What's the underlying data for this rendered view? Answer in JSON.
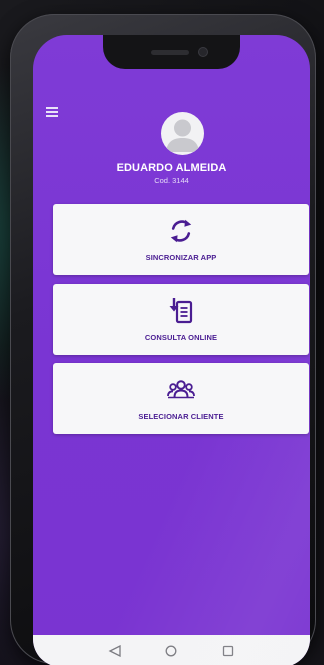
{
  "user": {
    "name": "EDUARDO ALMEIDA",
    "code": "Cod. 3144"
  },
  "menu": {
    "icon": "hamburger-menu-icon"
  },
  "cards": [
    {
      "label": "SINCRONIZAR APP",
      "icon": "sync-icon"
    },
    {
      "label": "CONSULTA ONLINE",
      "icon": "document-download-icon"
    },
    {
      "label": "SELECIONAR CLIENTE",
      "icon": "users-group-icon"
    }
  ],
  "navigation": {
    "back": "back-triangle-icon",
    "home": "home-circle-icon",
    "recents": "recents-square-icon"
  },
  "colors": {
    "screen_background": "#7a35d3",
    "card_background": "#f7f7f9",
    "accent": "#4a1d92",
    "nav_bar": "#f4f4f6"
  }
}
